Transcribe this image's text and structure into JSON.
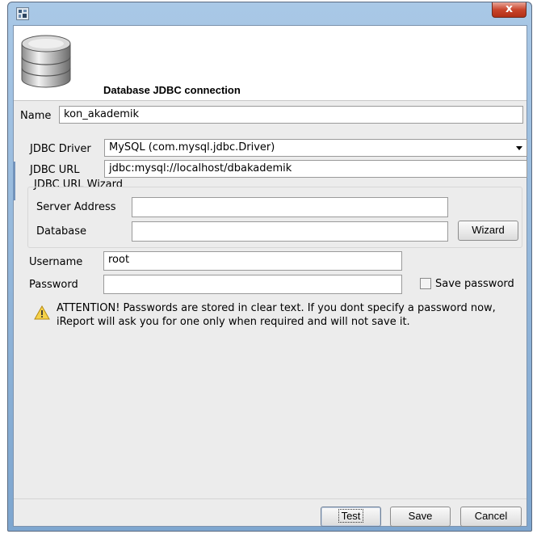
{
  "window": {
    "close_label": "x"
  },
  "header": {
    "title": "Database JDBC connection",
    "icon": "database-icon"
  },
  "form": {
    "name_label": "Name",
    "name_value": "kon_akademik",
    "driver_label": "JDBC Driver",
    "driver_value": "MySQL (com.mysql.jdbc.Driver)",
    "url_label": "JDBC URL",
    "url_value": "jdbc:mysql://localhost/dbakademik",
    "wizard_group_label": "JDBC URL Wizard",
    "server_label": "Server Address",
    "server_value": "",
    "database_label": "Database",
    "database_value": "",
    "wizard_button": "Wizard",
    "username_label": "Username",
    "username_value": "root",
    "password_label": "Password",
    "password_value": "",
    "save_password_label": "Save password",
    "save_password_checked": false
  },
  "warning": {
    "icon": "warning-icon",
    "text": "ATTENTION! Passwords are stored in clear text. If you dont specify a password now, iReport will ask you for one only when required and will not save it."
  },
  "buttons": {
    "test": "Test",
    "save": "Save",
    "cancel": "Cancel"
  }
}
